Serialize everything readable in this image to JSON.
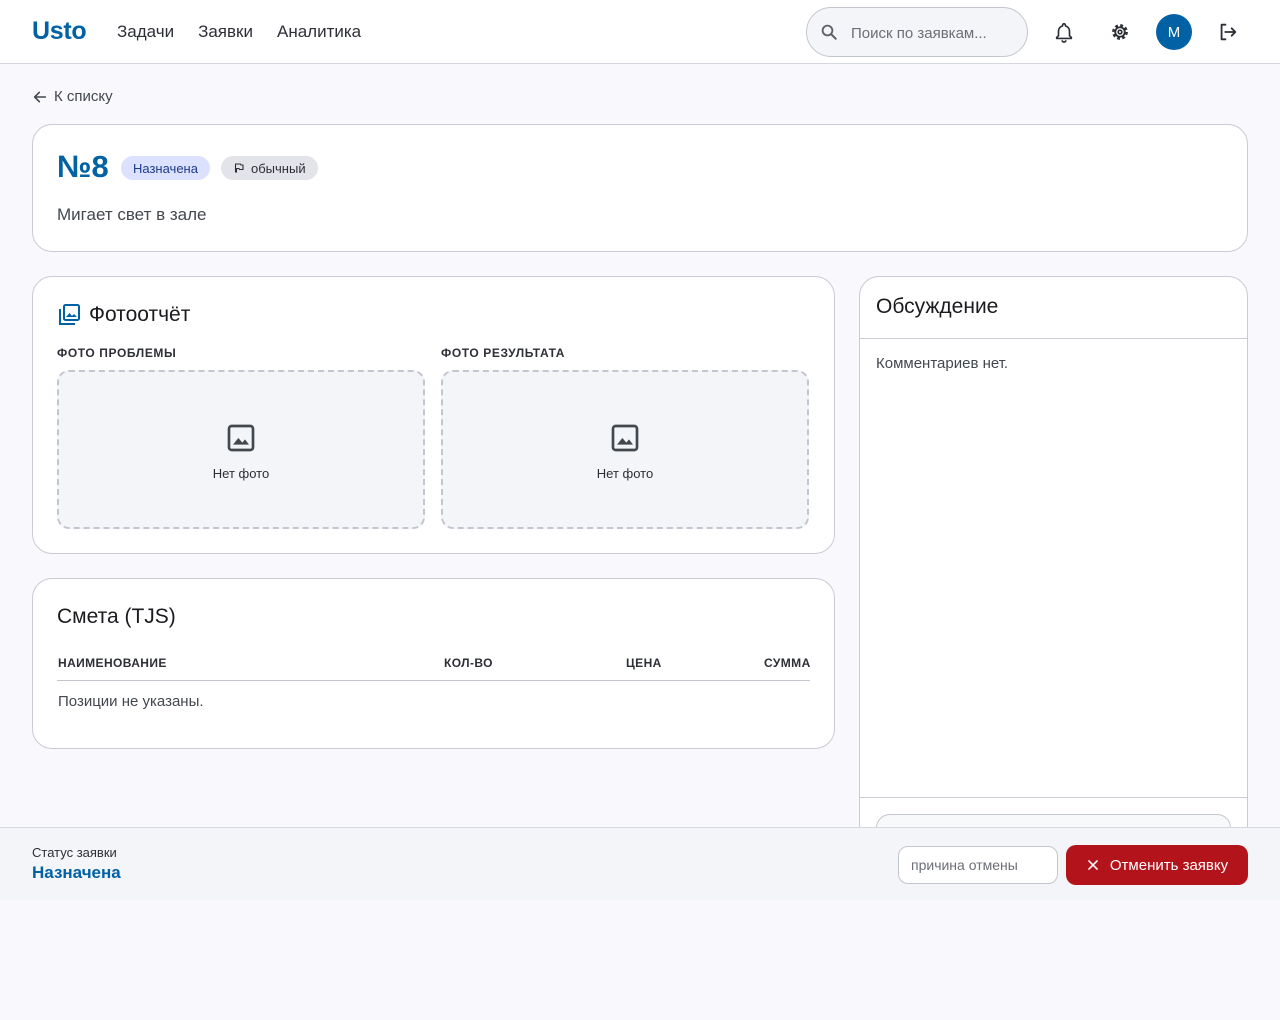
{
  "app": {
    "logo": "Usto"
  },
  "nav": [
    {
      "label": "Задачи"
    },
    {
      "label": "Заявки"
    },
    {
      "label": "Аналитика"
    }
  ],
  "search": {
    "placeholder": "Поиск по заявкам...",
    "value": ""
  },
  "user": {
    "avatar_initial": "M"
  },
  "back_link": {
    "label": "К списку"
  },
  "request": {
    "number": "№8",
    "status_chip": "Назначена",
    "priority_chip": "обычный",
    "title": "Мигает свет в зале"
  },
  "photo_report": {
    "heading": "Фотоотчёт",
    "problem_label": "ФОТО ПРОБЛЕМЫ",
    "result_label": "ФОТО РЕЗУЛЬТАТА",
    "problem_empty": "Нет фото",
    "result_empty": "Нет фото"
  },
  "estimate": {
    "heading": "Смета (TJS)",
    "columns": [
      "НАИМЕНОВАНИЕ",
      "КОЛ-ВО",
      "ЦЕНА",
      "СУММА"
    ],
    "empty": "Позиции не указаны."
  },
  "discussion": {
    "heading": "Обсуждение",
    "empty": "Комментариев нет."
  },
  "status_bar": {
    "label": "Статус заявки",
    "value": "Назначена",
    "reason_placeholder": "причина отмены",
    "cancel_label": "Отменить заявку"
  },
  "colors": {
    "primary": "#0061a4",
    "danger": "#b3141b",
    "status_chip_bg": "#dbe1ff",
    "background": "#f9f9fd"
  },
  "icons": {
    "search": "search-icon",
    "notifications": "bell-icon",
    "settings": "gear-icon",
    "logout": "logout-icon",
    "back": "arrow-left-icon",
    "priority": "flag-icon",
    "photo_report": "photo-library-icon",
    "no_photo": "image-icon",
    "cancel": "close-icon"
  }
}
